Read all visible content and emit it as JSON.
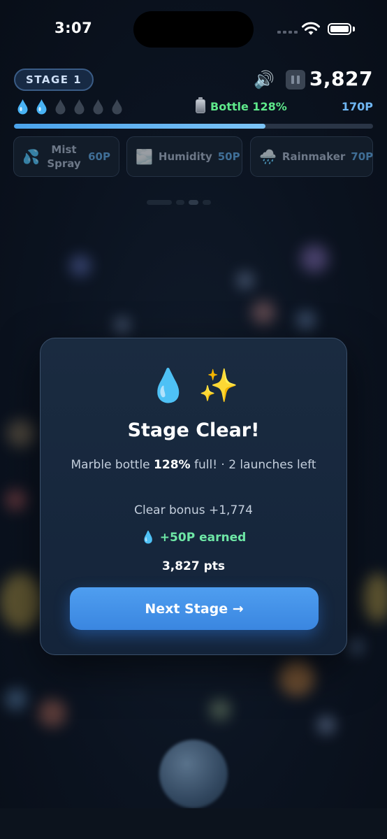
{
  "status_bar": {
    "time": "3:07"
  },
  "hud": {
    "stage": "STAGE 1",
    "score": "3,827",
    "drops_total": 6,
    "drops_filled": 2,
    "bottle_label": "Bottle 128%",
    "points": "170P",
    "progress": 0.7
  },
  "powerups": [
    {
      "label": "Mist Spray",
      "cost": "60P",
      "icon": "mist-spray-icon"
    },
    {
      "label": "Humidity",
      "cost": "50P",
      "icon": "humidity-icon"
    },
    {
      "label": "Rainmaker",
      "cost": "70P",
      "icon": "rainmaker-icon"
    }
  ],
  "modal": {
    "emoji": "💧 ✨",
    "title": "Stage Clear!",
    "desc_prefix": "Marble bottle ",
    "desc_bold": "128%",
    "desc_suffix": " full! · 2 launches left",
    "bonus": "Clear bonus +1,774",
    "earned": "💧 +50P earned",
    "points": "3,827 pts",
    "button": "Next Stage →"
  },
  "colors": {
    "accent_blue": "#4f9ef0",
    "bottle_green": "#5ee88a",
    "earned_green": "#6ee7a6",
    "points_blue": "#6fb6f2"
  }
}
